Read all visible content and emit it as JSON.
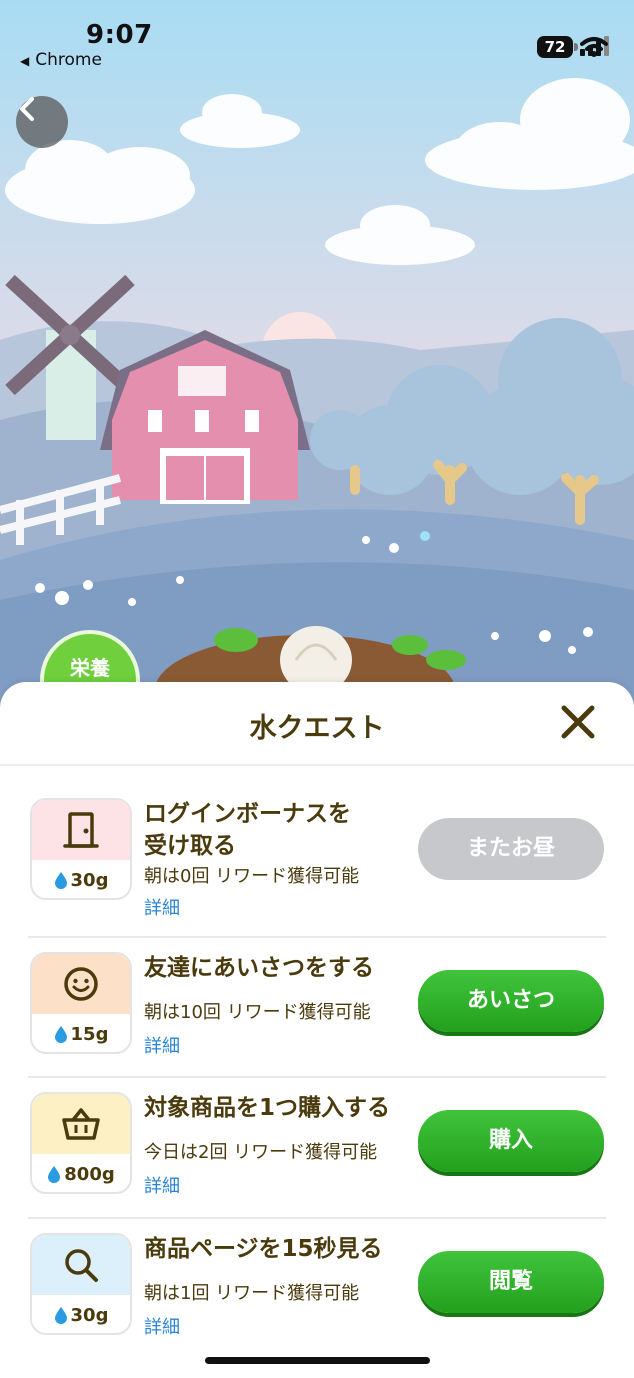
{
  "status_bar": {
    "time": "9:07",
    "back_app": "Chrome",
    "battery": "72"
  },
  "scene": {
    "badge_label": "栄養"
  },
  "sheet": {
    "title": "水クエスト",
    "close_icon": "close-icon"
  },
  "quests": [
    {
      "icon": "door-icon",
      "icon_bg": "#fde3e6",
      "reward": "30g",
      "title_line1": "ログインボーナスを",
      "title_line2": "受け取る",
      "sub": "朝は0回 リワード獲得可能",
      "detail": "詳細",
      "button": "またお昼",
      "button_state": "disabled"
    },
    {
      "icon": "smiley-icon",
      "icon_bg": "#fde0c8",
      "reward": "15g",
      "title_line1": "友達にあいさつをする",
      "title_line2": "",
      "sub": "朝は10回 リワード獲得可能",
      "detail": "詳細",
      "button": "あいさつ",
      "button_state": "enabled"
    },
    {
      "icon": "basket-icon",
      "icon_bg": "#fdf0c4",
      "reward": "800g",
      "title_line1": "対象商品を1つ購入する",
      "title_line2": "",
      "sub": "今日は2回 リワード獲得可能",
      "detail": "詳細",
      "button": "購入",
      "button_state": "enabled"
    },
    {
      "icon": "search-icon",
      "icon_bg": "#dcf0fb",
      "reward": "30g",
      "title_line1": "商品ページを15秒見る",
      "title_line2": "",
      "sub": "朝は1回 リワード獲得可能",
      "detail": "詳細",
      "button": "閲覧",
      "button_state": "enabled"
    }
  ],
  "colors": {
    "text_brown": "#4a3a0c",
    "link_blue": "#2a84d6",
    "button_green": "#23a01e",
    "button_gray": "#c7c8cc",
    "water_blue": "#2a9be0"
  }
}
